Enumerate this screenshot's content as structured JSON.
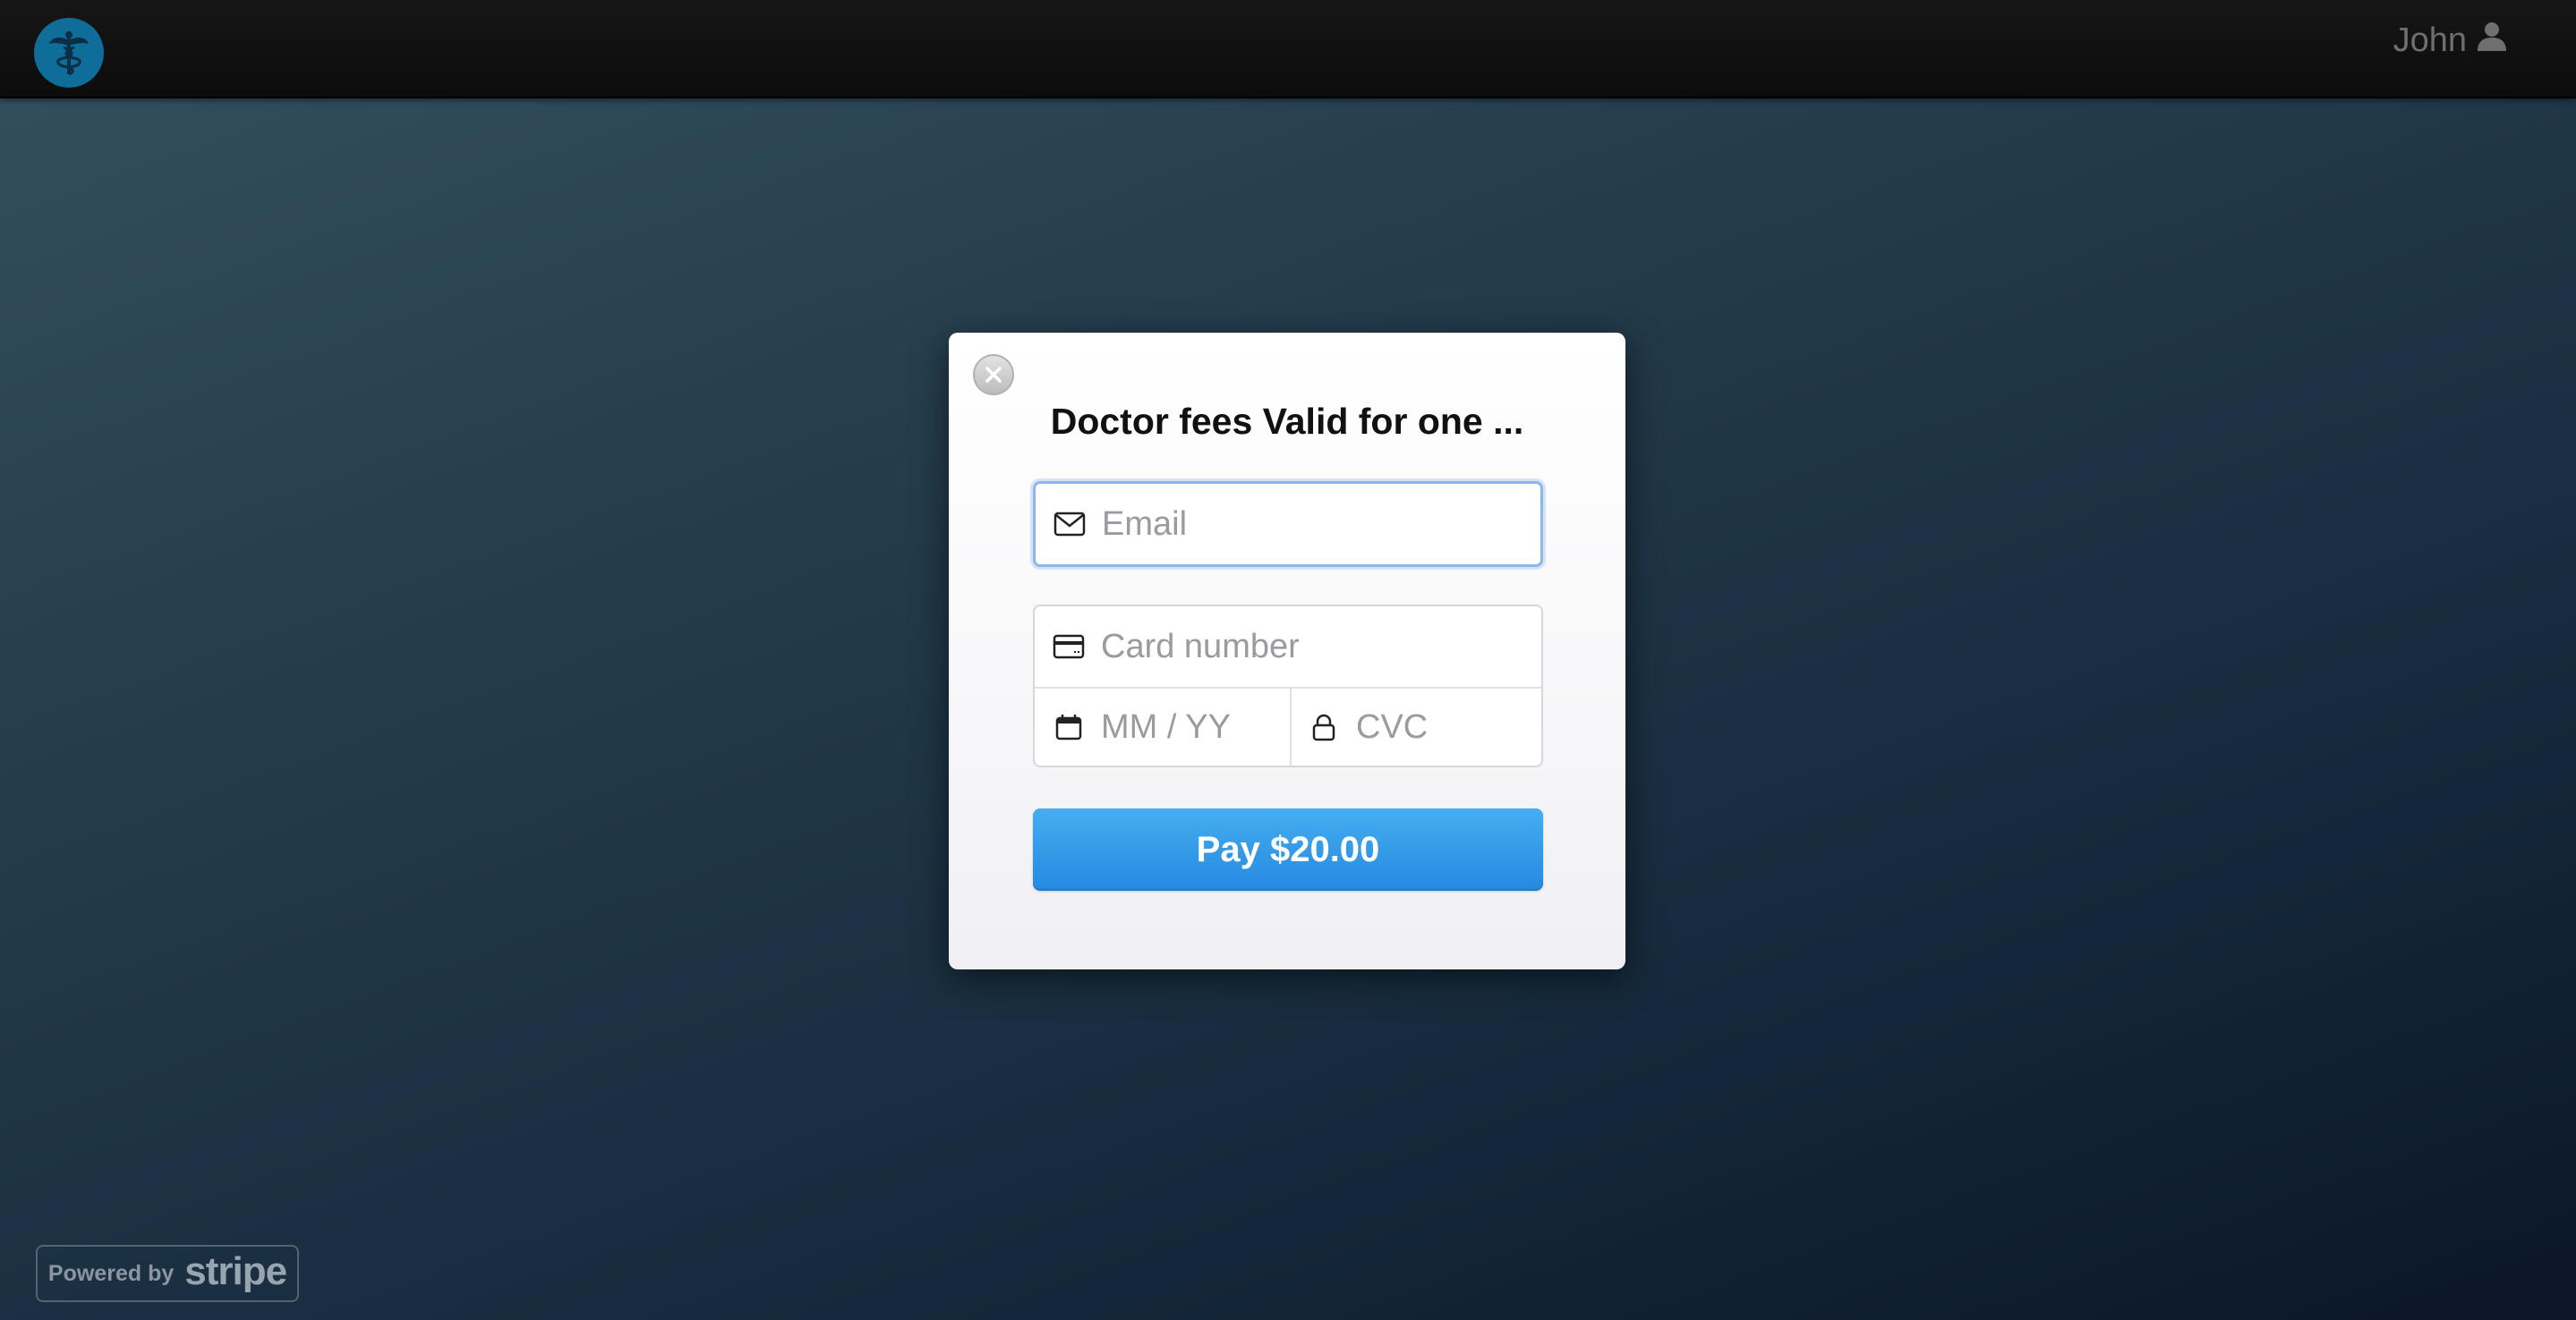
{
  "header": {
    "logo_icon": "caduceus-icon",
    "user_name": "John",
    "user_icon": "user-icon"
  },
  "checkout": {
    "title": "Doctor fees Valid for one ...",
    "close_icon": "close-icon",
    "email": {
      "icon": "envelope-icon",
      "placeholder": "Email",
      "value": ""
    },
    "card_number": {
      "icon": "credit-card-icon",
      "placeholder": "Card number",
      "value": ""
    },
    "expiry": {
      "icon": "calendar-icon",
      "placeholder": "MM / YY",
      "value": ""
    },
    "cvc": {
      "icon": "lock-icon",
      "placeholder": "CVC",
      "value": ""
    },
    "pay_label": "Pay $20.00"
  },
  "footer": {
    "powered_text": "Powered by",
    "brand": "stripe"
  },
  "colors": {
    "pay_button": "#3198e8",
    "logo": "#0e6d99",
    "focus_border": "#8db6ef"
  }
}
